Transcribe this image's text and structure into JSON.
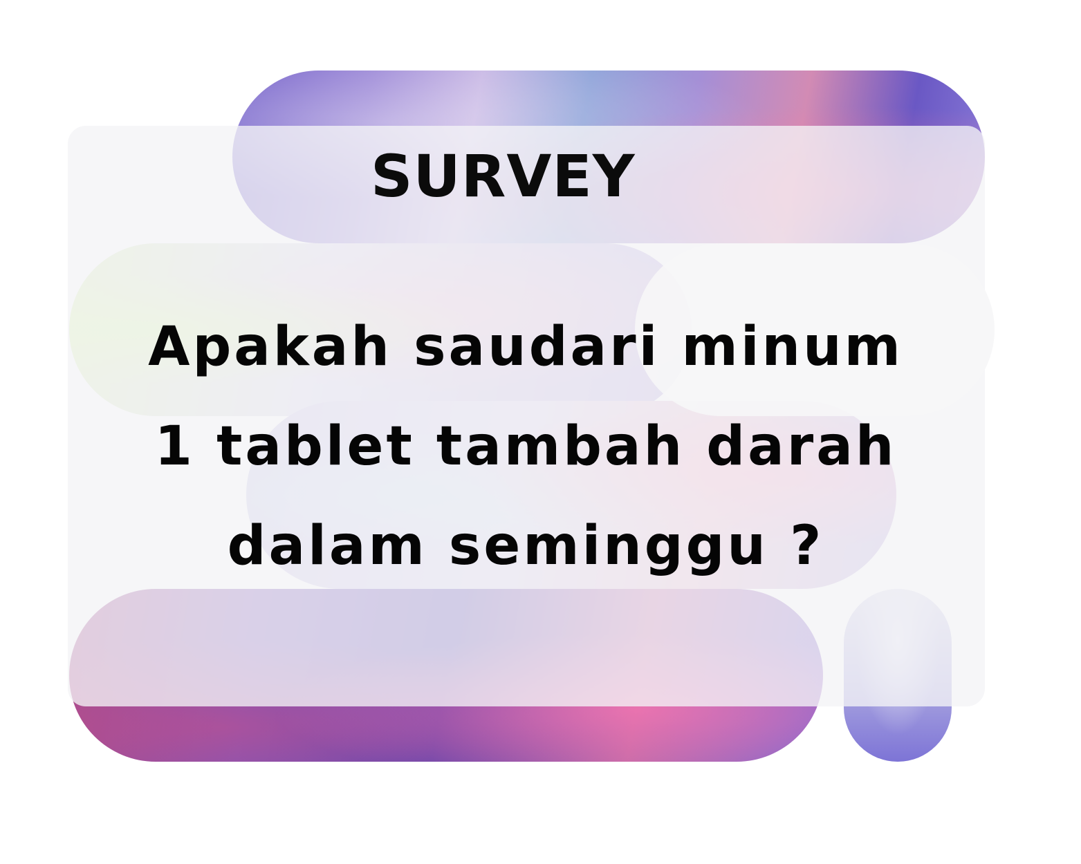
{
  "survey": {
    "heading": "SURVEY",
    "question_lines": [
      "Apakah saudari minum",
      "1 tablet tambah darah",
      "dalam seminggu ?"
    ]
  },
  "colors": {
    "text": "#050505",
    "card": "#f4f4f6",
    "holo_purple": "#6f5cc8",
    "holo_pink": "#d28bb4",
    "holo_green": "#d9f0b3"
  }
}
